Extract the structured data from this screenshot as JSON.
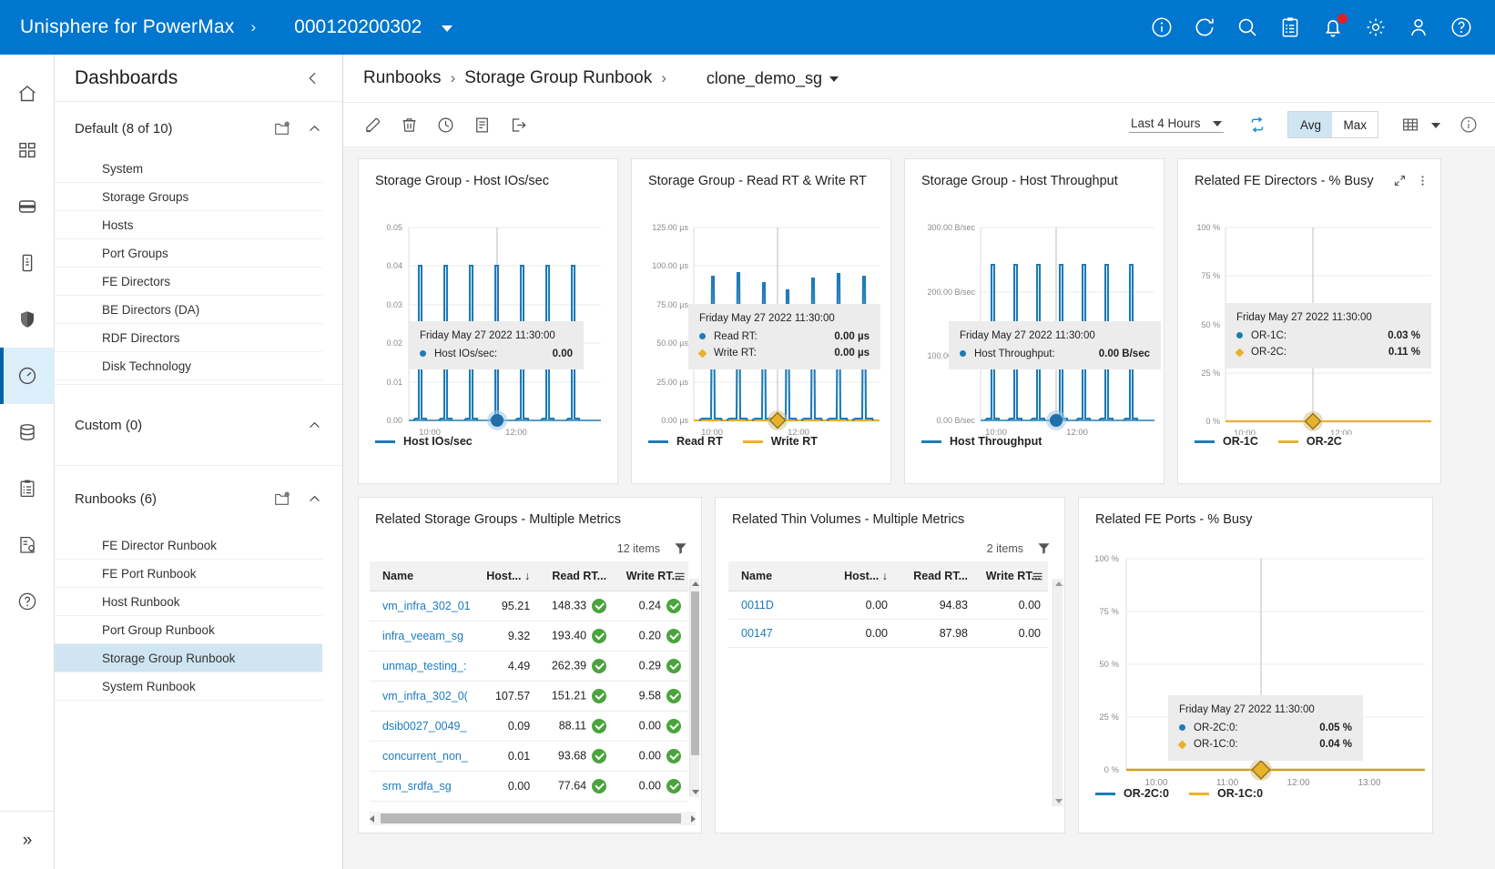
{
  "topbar": {
    "brand": "Unisphere for PowerMax",
    "separator": "›",
    "system_id": "000120200302",
    "icons": [
      "info-icon",
      "refresh-icon",
      "search-icon",
      "jobs-clipboard-icon",
      "alerts-bell-icon",
      "settings-gear-icon",
      "user-icon",
      "help-icon"
    ],
    "accent_color": "#0076ce"
  },
  "rail": {
    "icons": [
      "home-icon",
      "dashboard-grid-icon",
      "storage-icon",
      "host-icon",
      "protection-shield-icon",
      "performance-gauge-icon",
      "database-icon",
      "jobs-clipboard-icon",
      "reports-icon",
      "help-circle-icon"
    ],
    "active_index": 5,
    "expand_label": "»"
  },
  "dashboards": {
    "title": "Dashboards",
    "collapse_icon": "chevron-left-icon",
    "groups": [
      {
        "label": "Default (8 of 10)",
        "add_icon": "new-folder-icon",
        "chevron": "chevron-up-icon",
        "items": [
          "System",
          "Storage Groups",
          "Hosts",
          "Port Groups",
          "FE Directors",
          "BE Directors (DA)",
          "RDF Directors",
          "Disk Technology"
        ],
        "selected": null
      },
      {
        "label": "Custom (0)",
        "add_icon": null,
        "chevron": "chevron-up-icon",
        "items": [],
        "selected": null
      },
      {
        "label": "Runbooks (6)",
        "add_icon": "new-folder-icon",
        "chevron": "chevron-up-icon",
        "items": [
          "FE Director Runbook",
          "FE Port Runbook",
          "Host Runbook",
          "Port Group Runbook",
          "Storage Group Runbook",
          "System Runbook"
        ],
        "selected": "Storage Group Runbook"
      }
    ]
  },
  "breadcrumb": {
    "root": "Runbooks",
    "sep": "›",
    "page": "Storage Group Runbook",
    "sep2": "›",
    "object": "clone_demo_sg"
  },
  "toolbar": {
    "icons": [
      "edit-pencil-icon",
      "delete-trash-icon",
      "schedule-clock-icon",
      "report-icon",
      "export-icon"
    ],
    "time_range": "Last 4 Hours",
    "refresh_icon": "auto-refresh-icon",
    "agg_avg": "Avg",
    "agg_max": "Max",
    "agg_selected": "Avg",
    "grid_icon": "grid-layout-icon",
    "info_icon": "info-icon"
  },
  "chart_data": [
    {
      "type": "line",
      "title": "Storage Group - Host IOs/sec",
      "ylabel": "",
      "xlabel": "",
      "yticks": [
        "0.05",
        "0.04",
        "0.03",
        "0.02",
        "0.01",
        "0.00"
      ],
      "ylim": [
        0,
        0.05
      ],
      "xticks": [
        "10:00",
        "12:00"
      ],
      "grid": true,
      "legend_position": "bottom",
      "series": [
        {
          "name": "Host IOs/sec",
          "color": "#1f7bb6",
          "marker": "circle",
          "peaks": [
            0.04,
            0.04,
            0.04,
            0.04,
            0.04,
            0.04,
            0.04
          ],
          "baseline": 0.0
        }
      ],
      "tooltip": {
        "time": "Friday May 27 2022 11:30:00",
        "rows": [
          {
            "marker": "circle",
            "color": "#1f7bb6",
            "key": "Host IOs/sec:",
            "value": "0.00"
          }
        ]
      }
    },
    {
      "type": "line",
      "title": "Storage Group - Read RT & Write RT",
      "yticks": [
        "125.00 µs",
        "100.00 µs",
        "75.00 µs",
        "50.00 µs",
        "25.00 µs",
        "0.00 µs"
      ],
      "ylim": [
        0,
        125
      ],
      "xticks": [
        "10:00",
        "12:00"
      ],
      "grid": true,
      "legend_position": "bottom",
      "series": [
        {
          "name": "Read RT",
          "color": "#1f7bb6",
          "marker": "circle",
          "peaks": [
            93,
            96,
            89,
            84,
            92,
            95,
            93
          ],
          "baseline": 0
        },
        {
          "name": "Write RT",
          "color": "#e8b12c",
          "marker": "diamond",
          "peaks": [
            0,
            0,
            0,
            0,
            0,
            0,
            0
          ],
          "baseline": 0
        }
      ],
      "tooltip": {
        "time": "Friday May 27 2022 11:30:00",
        "rows": [
          {
            "marker": "circle",
            "color": "#1f7bb6",
            "key": "Read RT:",
            "value": "0.00 µs"
          },
          {
            "marker": "diamond",
            "color": "#e8b12c",
            "key": "Write RT:",
            "value": "0.00 µs"
          }
        ]
      }
    },
    {
      "type": "line",
      "title": "Storage Group - Host Throughput",
      "yticks": [
        "300.00 B/sec",
        "200.00 B/sec",
        "100.00 B/sec",
        "0.00 B/sec"
      ],
      "ylim": [
        0,
        300
      ],
      "xticks": [
        "10:00",
        "12:00"
      ],
      "grid": true,
      "legend_position": "bottom",
      "series": [
        {
          "name": "Host Throughput",
          "color": "#1f7bb6",
          "marker": "circle",
          "peaks": [
            245,
            245,
            245,
            245,
            245,
            245,
            245
          ],
          "baseline": 0
        }
      ],
      "tooltip": {
        "time": "Friday May 27 2022 11:30:00",
        "rows": [
          {
            "marker": "circle",
            "color": "#1f7bb6",
            "key": "Host Throughput:",
            "value": "0.00 B/sec"
          }
        ]
      }
    },
    {
      "type": "line",
      "title": "Related FE Directors - % Busy",
      "yticks": [
        "100 %",
        "75 %",
        "50 %",
        "25 %",
        "0 %"
      ],
      "ylim": [
        0,
        100
      ],
      "xticks": [
        "10:00",
        "12:00"
      ],
      "grid": true,
      "legend_position": "bottom",
      "header_icons": [
        "expand-icon",
        "kebab-menu-icon"
      ],
      "series": [
        {
          "name": "OR-1C",
          "color": "#1f7bb6",
          "marker": "circle",
          "peaks": [
            0.03
          ],
          "baseline": 0
        },
        {
          "name": "OR-2C",
          "color": "#e8b12c",
          "marker": "diamond",
          "peaks": [
            0.11
          ],
          "baseline": 0
        }
      ],
      "tooltip": {
        "time": "Friday May 27 2022 11:30:00",
        "rows": [
          {
            "marker": "circle",
            "color": "#1f7bb6",
            "key": "OR-1C:",
            "value": "0.03 %"
          },
          {
            "marker": "diamond",
            "color": "#e8b12c",
            "key": "OR-2C:",
            "value": "0.11 %"
          }
        ]
      }
    },
    {
      "type": "line",
      "title": "Related FE Ports - % Busy",
      "yticks": [
        "100 %",
        "75 %",
        "50 %",
        "25 %",
        "0 %"
      ],
      "ylim": [
        0,
        100
      ],
      "xticks": [
        "10:00",
        "11:00",
        "12:00",
        "13:00"
      ],
      "grid": true,
      "legend_position": "bottom",
      "series": [
        {
          "name": "OR-2C:0",
          "color": "#1f7bb6",
          "marker": "circle",
          "peaks": [
            0.05
          ],
          "baseline": 0
        },
        {
          "name": "OR-1C:0",
          "color": "#e8b12c",
          "marker": "diamond",
          "peaks": [
            0.04
          ],
          "baseline": 0
        }
      ],
      "tooltip": {
        "time": "Friday May 27 2022 11:30:00",
        "rows": [
          {
            "marker": "circle",
            "color": "#1f7bb6",
            "key": "OR-2C:0:",
            "value": "0.05 %"
          },
          {
            "marker": "diamond",
            "color": "#e8b12c",
            "key": "OR-1C:0:",
            "value": "0.04 %"
          }
        ]
      }
    }
  ],
  "tables": [
    {
      "title": "Related Storage Groups - Multiple Metrics",
      "count": "12 items",
      "filter_icon": "funnel-icon",
      "menu_icon": "hamburger-menu-icon",
      "columns": [
        "Name",
        "Host...",
        "Read RT...",
        "Write RT..."
      ],
      "sort_col": 1,
      "sort_dir": "↓",
      "rows": [
        {
          "name": "vm_infra_302_01",
          "host": "95.21",
          "read_rt": "148.33",
          "write_rt": "0.24"
        },
        {
          "name": "infra_veeam_sg",
          "host": "9.32",
          "read_rt": "193.40",
          "write_rt": "0.20"
        },
        {
          "name": "unmap_testing_:",
          "host": "4.49",
          "read_rt": "262.39",
          "write_rt": "0.29"
        },
        {
          "name": "vm_infra_302_0(",
          "host": "107.57",
          "read_rt": "151.21",
          "write_rt": "9.58"
        },
        {
          "name": "dsib0027_0049_",
          "host": "0.09",
          "read_rt": "88.11",
          "write_rt": "0.00"
        },
        {
          "name": "concurrent_non_",
          "host": "0.01",
          "read_rt": "93.68",
          "write_rt": "0.00"
        },
        {
          "name": "srm_srdfa_sg",
          "host": "0.00",
          "read_rt": "77.64",
          "write_rt": "0.00"
        }
      ]
    },
    {
      "title": "Related Thin Volumes - Multiple Metrics",
      "count": "2 items",
      "filter_icon": "funnel-icon",
      "menu_icon": "hamburger-menu-icon",
      "columns": [
        "Name",
        "Host...",
        "Read RT...",
        "Write RT..."
      ],
      "sort_col": 1,
      "sort_dir": "↓",
      "rows": [
        {
          "name": "0011D",
          "host": "0.00",
          "read_rt": "94.83",
          "write_rt": "0.00"
        },
        {
          "name": "00147",
          "host": "0.00",
          "read_rt": "87.98",
          "write_rt": "0.00"
        }
      ]
    }
  ]
}
